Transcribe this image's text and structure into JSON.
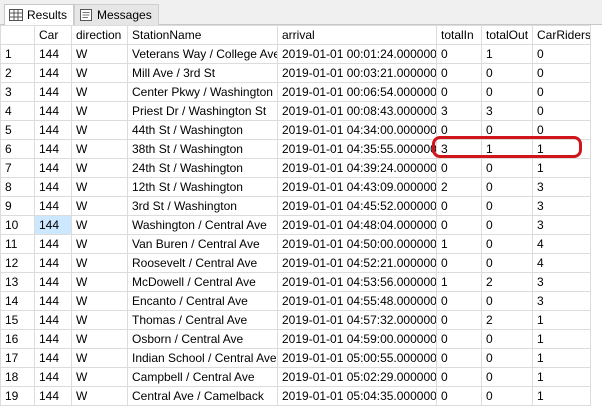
{
  "tabs": [
    {
      "label": "Results",
      "icon": "results-grid-icon",
      "active": true
    },
    {
      "label": "Messages",
      "icon": "messages-icon",
      "active": false
    }
  ],
  "columns": [
    "",
    "Car",
    "direction",
    "StationName",
    "arrival",
    "totalIn",
    "totalOut",
    "CarRiders"
  ],
  "rows": [
    [
      "1",
      "144",
      "W",
      "Veterans Way / College Ave",
      "2019-01-01 00:01:24.0000000",
      "0",
      "1",
      "0"
    ],
    [
      "2",
      "144",
      "W",
      "Mill Ave / 3rd St",
      "2019-01-01 00:03:21.0000000",
      "0",
      "0",
      "0"
    ],
    [
      "3",
      "144",
      "W",
      "Center Pkwy / Washington",
      "2019-01-01 00:06:54.0000000",
      "0",
      "0",
      "0"
    ],
    [
      "4",
      "144",
      "W",
      "Priest Dr / Washington St",
      "2019-01-01 00:08:43.0000000",
      "3",
      "3",
      "0"
    ],
    [
      "5",
      "144",
      "W",
      "44th St / Washington",
      "2019-01-01 04:34:00.0000000",
      "0",
      "0",
      "0"
    ],
    [
      "6",
      "144",
      "W",
      "38th St / Washington",
      "2019-01-01 04:35:55.0000000",
      "3",
      "1",
      "1"
    ],
    [
      "7",
      "144",
      "W",
      "24th St / Washington",
      "2019-01-01 04:39:24.0000000",
      "0",
      "0",
      "1"
    ],
    [
      "8",
      "144",
      "W",
      "12th St / Washington",
      "2019-01-01 04:43:09.0000000",
      "2",
      "0",
      "3"
    ],
    [
      "9",
      "144",
      "W",
      "3rd St / Washington",
      "2019-01-01 04:45:52.0000000",
      "0",
      "0",
      "3"
    ],
    [
      "10",
      "144",
      "W",
      "Washington / Central Ave",
      "2019-01-01 04:48:04.0000000",
      "0",
      "0",
      "3"
    ],
    [
      "11",
      "144",
      "W",
      "Van Buren / Central Ave",
      "2019-01-01 04:50:00.0000000",
      "1",
      "0",
      "4"
    ],
    [
      "12",
      "144",
      "W",
      "Roosevelt / Central Ave",
      "2019-01-01 04:52:21.0000000",
      "0",
      "0",
      "4"
    ],
    [
      "13",
      "144",
      "W",
      "McDowell / Central Ave",
      "2019-01-01 04:53:56.0000000",
      "1",
      "2",
      "3"
    ],
    [
      "14",
      "144",
      "W",
      "Encanto / Central Ave",
      "2019-01-01 04:55:48.0000000",
      "0",
      "0",
      "3"
    ],
    [
      "15",
      "144",
      "W",
      "Thomas / Central Ave",
      "2019-01-01 04:57:32.0000000",
      "0",
      "2",
      "1"
    ],
    [
      "16",
      "144",
      "W",
      "Osborn / Central Ave",
      "2019-01-01 04:59:00.0000000",
      "0",
      "0",
      "1"
    ],
    [
      "17",
      "144",
      "W",
      "Indian School / Central Ave",
      "2019-01-01 05:00:55.0000000",
      "0",
      "0",
      "1"
    ],
    [
      "18",
      "144",
      "W",
      "Campbell / Central Ave",
      "2019-01-01 05:02:29.0000000",
      "0",
      "0",
      "1"
    ],
    [
      "19",
      "144",
      "W",
      "Central Ave / Camelback",
      "2019-01-01 05:04:35.0000000",
      "0",
      "0",
      "1"
    ]
  ],
  "selected_cell": {
    "row": 10,
    "column": "Car"
  },
  "highlight": {
    "row": 6,
    "columns": [
      "totalIn",
      "totalOut",
      "CarRiders"
    ],
    "color": "#d0161b"
  }
}
